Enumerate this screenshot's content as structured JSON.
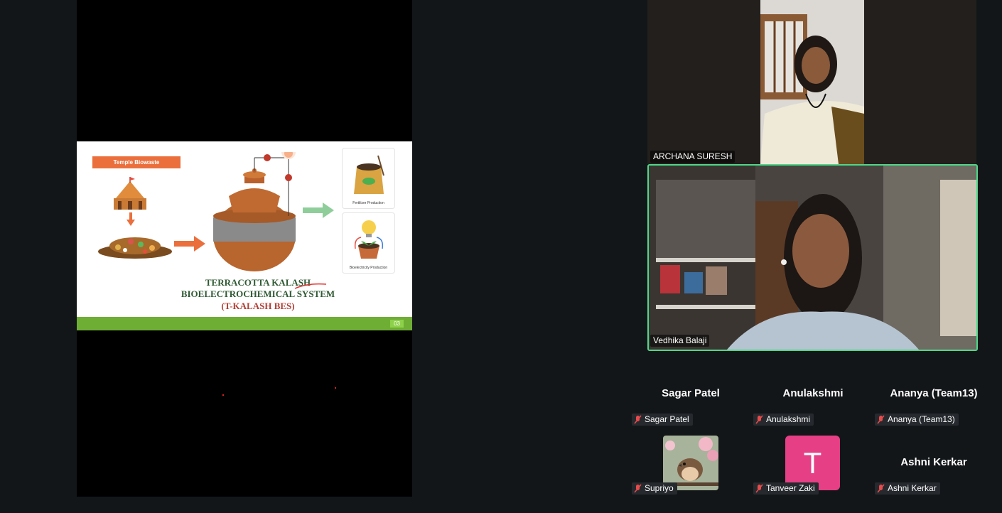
{
  "share": {
    "slide": {
      "tag": "Temple Biowaste",
      "title_line1": "TERRACOTTA KALASH",
      "title_line2": "BIOELECTROCHEMICAL SYSTEM",
      "title_line3": "(T-KALASH BES)",
      "output1": "Fertilizer Production",
      "output2": "Bioelectricity Production",
      "page_number": "03"
    }
  },
  "videos": {
    "archana": {
      "name": "ARCHANA SURESH"
    },
    "vedhika": {
      "name": "Vedhika Balaji"
    }
  },
  "gallery": {
    "tiles": [
      {
        "heading": "Sagar Patel",
        "label": "Sagar Patel"
      },
      {
        "heading": "Anulakshmi",
        "label": "Anulakshmi"
      },
      {
        "heading": "Ananya (Team13)",
        "label": "Ananya (Team13)"
      },
      {
        "label": "Supriyo"
      },
      {
        "initial": "T",
        "label": "Tanveer Zaki"
      },
      {
        "heading": "Ashni Kerkar",
        "label": "Ashni Kerkar"
      }
    ]
  },
  "colors": {
    "active_speaker_border": "#4ed889",
    "avatar_t": "#e63f85",
    "muted_icon": "#e84b4b"
  }
}
